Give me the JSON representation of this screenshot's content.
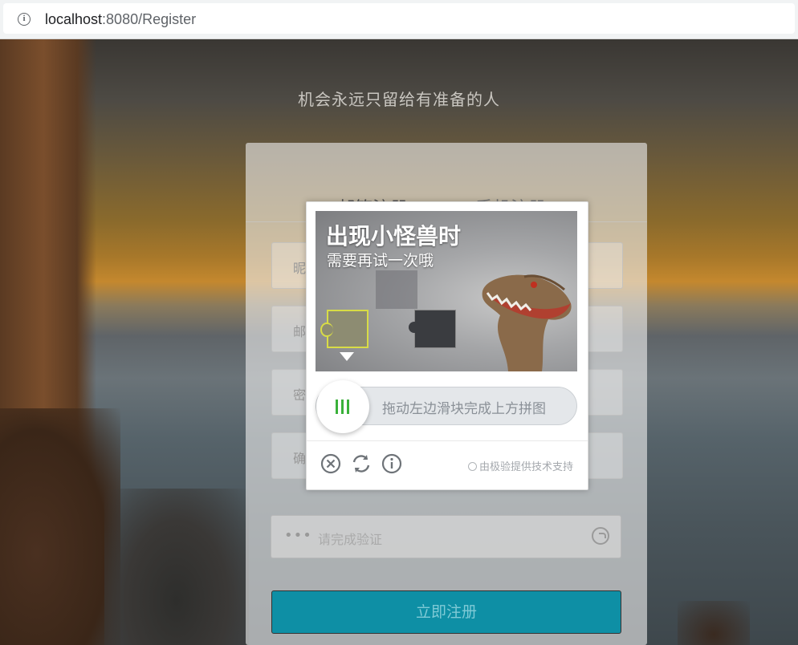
{
  "browser": {
    "url_host": "localhost",
    "url_rest": ":8080/Register"
  },
  "page": {
    "slogan": "机会永远只留给有准备的人"
  },
  "register_card": {
    "tabs": [
      {
        "label": "邮箱注册"
      },
      {
        "label": "手机注册"
      }
    ],
    "fields": [
      {
        "label": "昵"
      },
      {
        "label": "邮"
      },
      {
        "label": "密"
      },
      {
        "label": "确"
      }
    ],
    "verify": {
      "dots": "•••",
      "hint": "请完成验证"
    },
    "submit_label": "立即注册"
  },
  "captcha": {
    "title": "出现小怪兽时",
    "subtitle": "需要再试一次哦",
    "slider_hint": "拖动左边滑块完成上方拼图",
    "powered_by": "由极验提供技术支持",
    "icons": [
      "close-icon",
      "refresh-icon",
      "info-icon"
    ]
  }
}
